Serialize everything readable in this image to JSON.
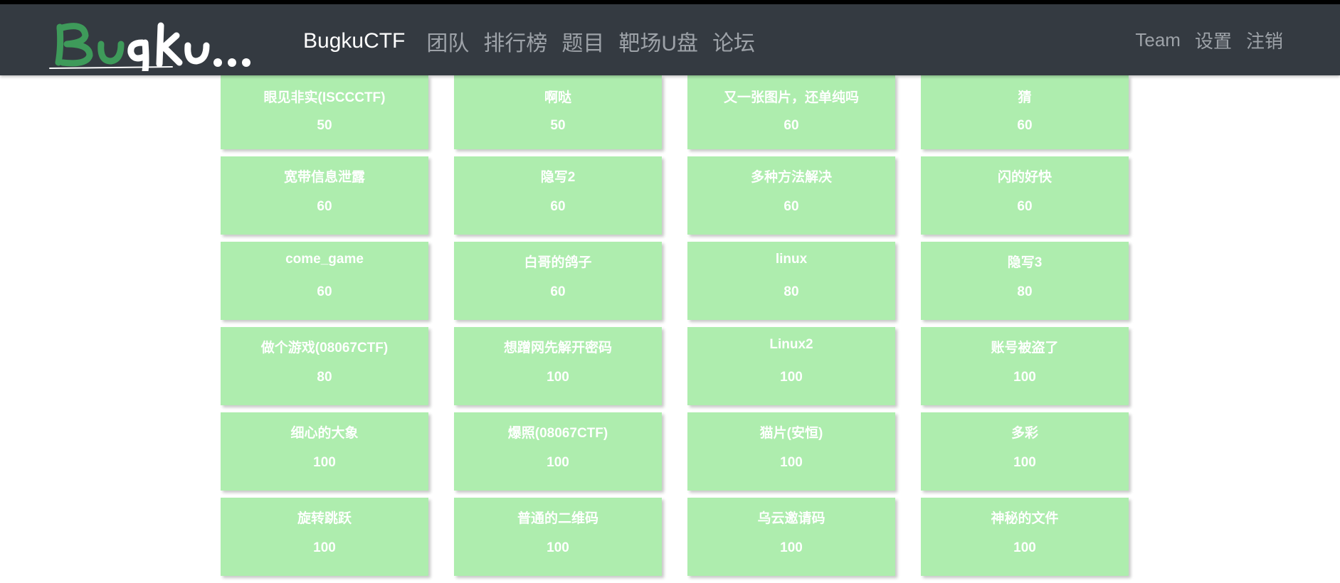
{
  "nav": {
    "logo_text": "Bugku...",
    "brand": "BugkuCTF",
    "items": [
      "团队",
      "排行榜",
      "题目",
      "靶场U盘",
      "论坛"
    ],
    "right_items": [
      "Team",
      "设置",
      "注销"
    ]
  },
  "colors": {
    "navbar": "#343a41",
    "card_bg": "#aeedae",
    "card_text": "#ffffff",
    "logo_green": "#3e9a5a"
  },
  "challenges": [
    {
      "title": "眼见非实(ISCCCTF)",
      "score": "50"
    },
    {
      "title": "啊哒",
      "score": "50"
    },
    {
      "title": "又一张图片，还单纯吗",
      "score": "60"
    },
    {
      "title": "猜",
      "score": "60"
    },
    {
      "title": "宽带信息泄露",
      "score": "60"
    },
    {
      "title": "隐写2",
      "score": "60"
    },
    {
      "title": "多种方法解决",
      "score": "60"
    },
    {
      "title": "闪的好快",
      "score": "60"
    },
    {
      "title": "come_game",
      "score": "60"
    },
    {
      "title": "白哥的鸽子",
      "score": "60"
    },
    {
      "title": "linux",
      "score": "80"
    },
    {
      "title": "隐写3",
      "score": "80"
    },
    {
      "title": "做个游戏(08067CTF)",
      "score": "80"
    },
    {
      "title": "想蹭网先解开密码",
      "score": "100"
    },
    {
      "title": "Linux2",
      "score": "100"
    },
    {
      "title": "账号被盗了",
      "score": "100"
    },
    {
      "title": "细心的大象",
      "score": "100"
    },
    {
      "title": "爆照(08067CTF)",
      "score": "100"
    },
    {
      "title": "猫片(安恒)",
      "score": "100"
    },
    {
      "title": "多彩",
      "score": "100"
    },
    {
      "title": "旋转跳跃",
      "score": "100"
    },
    {
      "title": "普通的二维码",
      "score": "100"
    },
    {
      "title": "乌云邀请码",
      "score": "100"
    },
    {
      "title": "神秘的文件",
      "score": "100"
    }
  ]
}
